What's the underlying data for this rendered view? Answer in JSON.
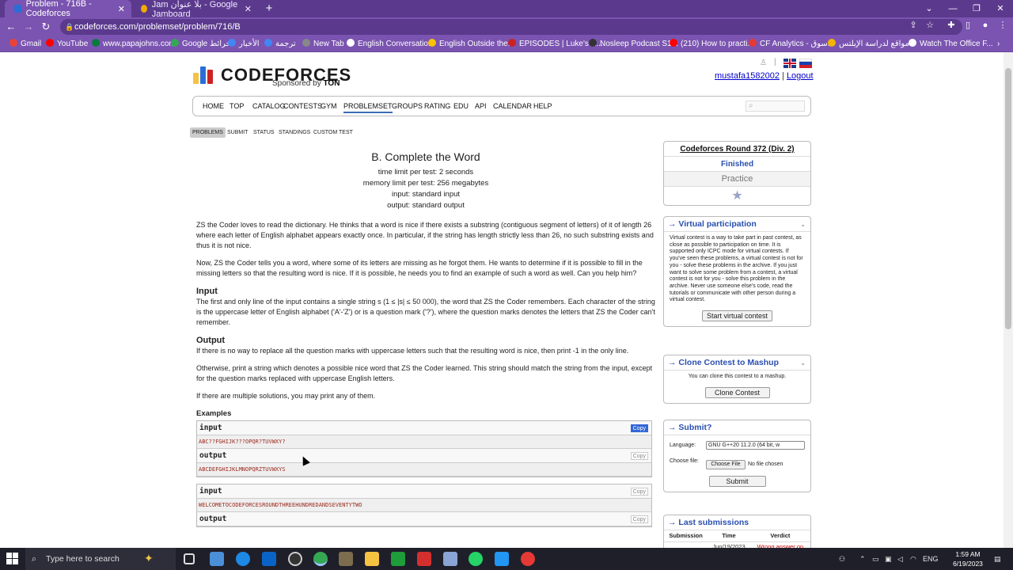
{
  "browser": {
    "tabs": [
      {
        "title": "Problem - 716B - Codeforces",
        "active": true,
        "favicon_color": "#2a6dd6"
      },
      {
        "title": "Jam بلا عنوان - Google Jamboard",
        "active": false,
        "favicon_color": "#f2a900"
      }
    ],
    "new_tab_label": "+",
    "url": "codeforces.com/problemset/problem/716/B",
    "bookmarks": [
      {
        "label": "Gmail",
        "color": "#ea4335"
      },
      {
        "label": "YouTube",
        "color": "#ff0000"
      },
      {
        "label": "www.papajohns.com",
        "color": "#0a7a3e"
      },
      {
        "label": "Google خرائط",
        "color": "#34a853"
      },
      {
        "label": "الأخبار",
        "color": "#4285f4"
      },
      {
        "label": "ترجمة",
        "color": "#4285f4"
      },
      {
        "label": "New Tab",
        "color": "#888888"
      },
      {
        "label": "English Conversatio...",
        "color": "#ffffff"
      },
      {
        "label": "English Outside the...",
        "color": "#f8c300"
      },
      {
        "label": "EPISODES | Luke's E...",
        "color": "#cc2222"
      },
      {
        "label": "Nosleep Podcast S1...",
        "color": "#333333"
      },
      {
        "label": "(210) How to practi...",
        "color": "#ff0000"
      },
      {
        "label": "CF Analytics - سوق...",
        "color": "#e53935"
      },
      {
        "label": "مواقع لدراسة الإيلتس...",
        "color": "#f4b400"
      },
      {
        "label": "Watch The Office F...",
        "color": "#ffffff"
      }
    ]
  },
  "site": {
    "logo_text": "CODEFORCES",
    "sponsored_prefix": "Sponsored by",
    "sponsored_brand": "TON",
    "username": "mustafa1582002",
    "separator": "|",
    "logout": "Logout",
    "menu": [
      "HOME",
      "TOP",
      "CATALOG",
      "CONTESTS",
      "GYM",
      "PROBLEMSET",
      "GROUPS",
      "RATING",
      "EDU",
      "API",
      "CALENDAR",
      "HELP"
    ],
    "menu_active": "PROBLEMSET",
    "subtabs": [
      "PROBLEMS",
      "SUBMIT",
      "STATUS",
      "STANDINGS",
      "CUSTOM TEST"
    ],
    "subtab_active": "PROBLEMS"
  },
  "problem": {
    "title": "B. Complete the Word",
    "time_limit": "time limit per test: 2 seconds",
    "memory_limit": "memory limit per test: 256 megabytes",
    "input_file": "input: standard input",
    "output_file": "output: standard output",
    "statement_1": "ZS the Coder loves to read the dictionary. He thinks that a word is nice if there exists a substring (contiguous segment of letters) of it of length 26 where each letter of English alphabet appears exactly once. In particular, if the string has length strictly less than 26, no such substring exists and thus it is not nice.",
    "statement_2": "Now, ZS the Coder tells you a word, where some of its letters are missing as he forgot them. He wants to determine if it is possible to fill in the missing letters so that the resulting word is nice. If it is possible, he needs you to find an example of such a word as well. Can you help him?",
    "input_title": "Input",
    "input_text": "The first and only line of the input contains a single string s (1 ≤ |s| ≤ 50 000), the word that ZS the Coder remembers. Each character of the string is the uppercase letter of English alphabet ('A'-'Z') or is a question mark ('?'), where the question marks denotes the letters that ZS the Coder can't remember.",
    "output_title": "Output",
    "output_text": "If there is no way to replace all the question marks with uppercase letters such that the resulting word is nice, then print -1 in the only line.",
    "output_text_2": "Otherwise, print a string which denotes a possible nice word that ZS the Coder learned. This string should match the string from the input, except for the question marks replaced with uppercase English letters.",
    "output_text_3": "If there are multiple solutions, you may print any of them.",
    "examples_title": "Examples",
    "input_label": "input",
    "output_label": "output",
    "copy_label": "Copy",
    "examples": [
      {
        "input": "ABC??FGHIJK???OPQR?TUVWXY?",
        "output": "ABCDEFGHIJKLMNOPQRZTUVWXYS"
      },
      {
        "input": "WELCOMETOCODEFORCESROUNDTHREEHUNDREDANDSEVENTYTWO",
        "output": ""
      }
    ]
  },
  "sidebar": {
    "contest_name": "Codeforces Round 372 (Div. 2)",
    "contest_status": "Finished",
    "practice": "Practice",
    "star_icon": "star-icon",
    "virtual_title": "→ Virtual participation",
    "virtual_text": "Virtual contest is a way to take part in past contest, as close as possible to participation on time. It is supported only ICPC mode for virtual contests. If you've seen these problems, a virtual contest is not for you - solve these problems in the archive. If you just want to solve some problem from a contest, a virtual contest is not for you - solve this problem in the archive. Never use someone else's code, read the tutorials or communicate with other person during a virtual contest.",
    "virtual_button": "Start virtual contest",
    "clone_title": "→ Clone Contest to Mashup",
    "clone_text": "You can clone this contest to a mashup.",
    "clone_button": "Clone Contest",
    "submit_title": "→ Submit?",
    "language_label": "Language:",
    "language_value": "GNU G++20 11.2.0 (64 bit, w",
    "choose_file_label": "Choose file:",
    "choose_file_button": "Choose File",
    "no_file": "No file chosen",
    "submit_button": "Submit",
    "last_title": "→ Last submissions",
    "table_headers": [
      "Submission",
      "Time",
      "Verdict"
    ],
    "last_row": [
      "",
      "Jun/19/2023",
      "Wrong answer on"
    ]
  },
  "taskbar": {
    "search_placeholder": "Type here to search",
    "lang": "ENG",
    "time": "1:59 AM",
    "date": "6/19/2023"
  }
}
